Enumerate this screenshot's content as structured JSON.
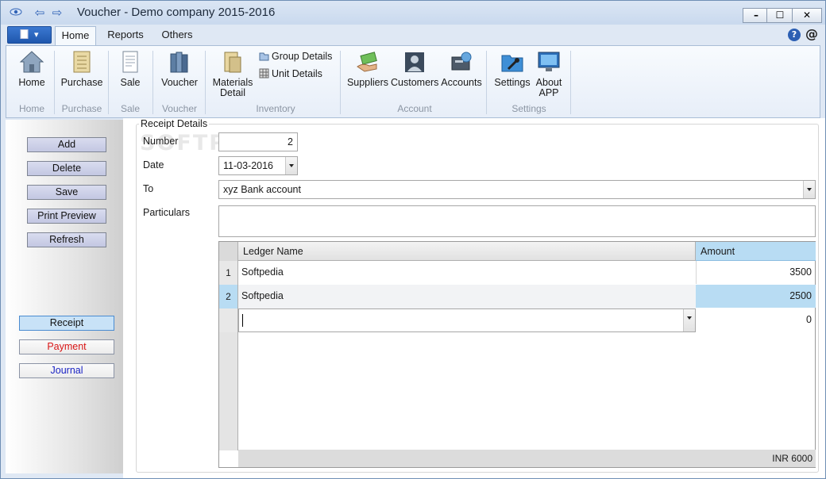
{
  "window": {
    "title": "Voucher - Demo company 2015-2016"
  },
  "tabs": [
    "Home",
    "Reports",
    "Others"
  ],
  "ribbon": {
    "home": {
      "label": "Home",
      "group": "Home"
    },
    "purchase": {
      "label": "Purchase",
      "group": "Purchase"
    },
    "sale": {
      "label": "Sale",
      "group": "Sale"
    },
    "voucher": {
      "label": "Voucher",
      "group": "Voucher"
    },
    "materials": {
      "label1": "Materials",
      "label2": "Detail"
    },
    "group_details": "Group Details",
    "unit_details": "Unit Details",
    "inventory_group": "Inventory",
    "suppliers": "Suppliers",
    "customers": "Customers",
    "accounts": "Accounts",
    "account_group": "Account",
    "settings": "Settings",
    "about": {
      "label1": "About",
      "label2": "APP"
    },
    "settings_group": "Settings"
  },
  "sidebar": {
    "actions": [
      "Add",
      "Delete",
      "Save",
      "Print Preview",
      "Refresh"
    ],
    "vouchers": [
      "Receipt",
      "Payment",
      "Journal"
    ]
  },
  "form": {
    "legend": "Receipt Details",
    "number_label": "Number",
    "number_value": "2",
    "date_label": "Date",
    "date_value": "11-03-2016",
    "to_label": "To",
    "to_value": "xyz Bank account",
    "particulars_label": "Particulars",
    "particulars_value": ""
  },
  "grid": {
    "columns": [
      "Ledger Name",
      "Amount"
    ],
    "rows": [
      {
        "num": "1",
        "ledger": "Softpedia",
        "amount": "3500"
      },
      {
        "num": "2",
        "ledger": "Softpedia",
        "amount": "2500"
      },
      {
        "num": "",
        "ledger": "",
        "amount": "0"
      }
    ],
    "total": "INR 6000"
  },
  "watermark": "SOFTPEDIA",
  "colors": {
    "accent": "#2c5fb3",
    "selected": "#c8e2f7",
    "payment": "#d91616",
    "journal": "#1a23c4"
  }
}
